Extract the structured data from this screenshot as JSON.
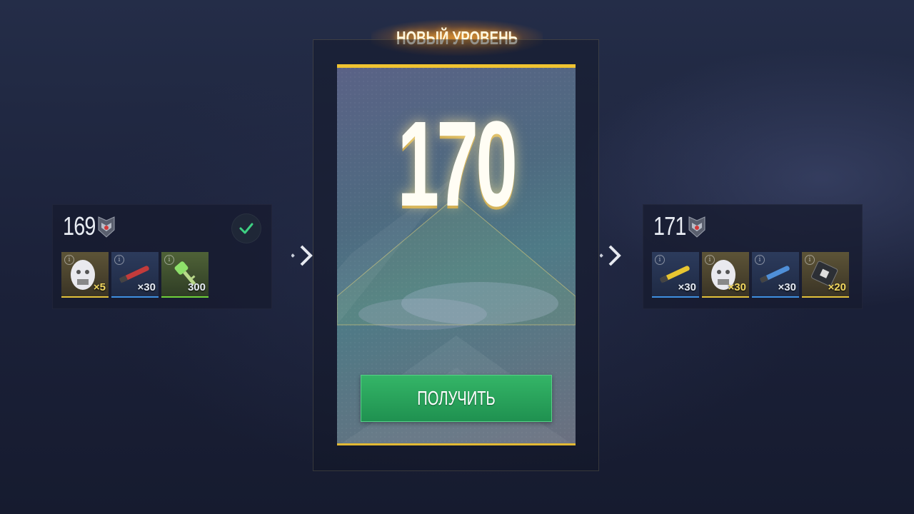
{
  "title": "НОВЫЙ УРОВЕНЬ",
  "current_level": "170",
  "claim_label": "ПОЛУЧИТЬ",
  "previous_level": {
    "level": "169",
    "claimed": true,
    "rewards": [
      {
        "icon": "consumable-face-icon",
        "rarity": "gold",
        "quantity": "×5"
      },
      {
        "icon": "red-shell-icon",
        "rarity": "blue",
        "quantity": "×30"
      },
      {
        "icon": "green-key-icon",
        "rarity": "green",
        "quantity": "300"
      }
    ]
  },
  "next_level": {
    "level": "171",
    "claimed": false,
    "rewards": [
      {
        "icon": "yellow-shell-icon",
        "rarity": "blue",
        "quantity": "×30"
      },
      {
        "icon": "consumable-face-icon",
        "rarity": "gold",
        "quantity": "×30"
      },
      {
        "icon": "blue-shell-icon",
        "rarity": "blue",
        "quantity": "×30"
      },
      {
        "icon": "repair-kit-icon",
        "rarity": "gold",
        "quantity": "×20"
      }
    ]
  },
  "colors": {
    "accent_gold": "#f0c431",
    "button_green": "#2aa35c",
    "check_green": "#3ed082"
  }
}
